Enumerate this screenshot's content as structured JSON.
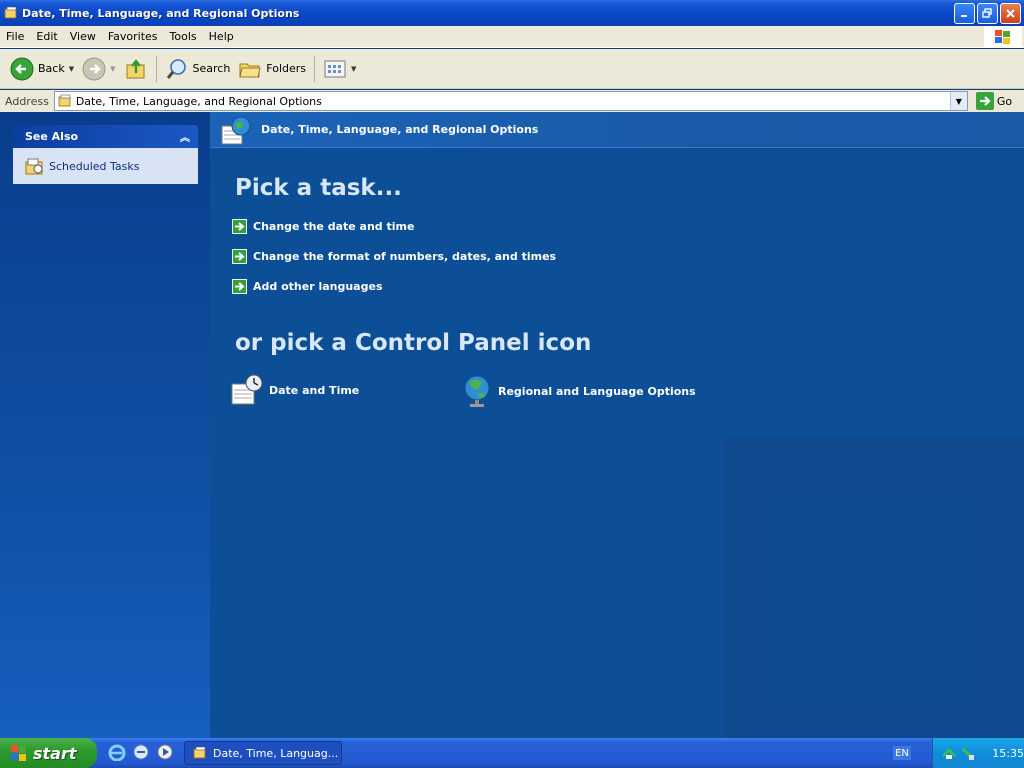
{
  "window": {
    "title": "Date, Time, Language, and Regional Options"
  },
  "menu": {
    "items": [
      "File",
      "Edit",
      "View",
      "Favorites",
      "Tools",
      "Help"
    ]
  },
  "toolbar": {
    "back_label": "Back",
    "search_label": "Search",
    "folders_label": "Folders"
  },
  "address": {
    "label": "Address",
    "value": "Date, Time, Language, and Regional Options",
    "go_label": "Go"
  },
  "sidebar": {
    "see_also_title": "See Also",
    "items": [
      {
        "label": "Scheduled Tasks",
        "icon": "scheduled-tasks-icon"
      }
    ]
  },
  "main": {
    "header_title": "Date, Time, Language, and Regional Options",
    "pick_task_heading": "Pick a task...",
    "tasks": [
      {
        "label": "Change the date and time"
      },
      {
        "label": "Change the format of numbers, dates, and times"
      },
      {
        "label": "Add other languages"
      }
    ],
    "pick_icon_heading": "or pick a Control Panel icon",
    "icons": [
      {
        "label": "Date and Time",
        "icon": "date-time-icon"
      },
      {
        "label": "Regional and Language Options",
        "icon": "globe-icon"
      }
    ]
  },
  "taskbar": {
    "start_label": "start",
    "active_task": "Date, Time, Languag...",
    "language": "EN",
    "clock": "15:35"
  },
  "colors": {
    "title_bar": "#0a47c8",
    "main_pane": "#0c4f96",
    "left_pane": "#0a3e8c",
    "heading": "#d9e6f6",
    "start_green": "#2e9b2e",
    "task_arrow": "#2fa33a"
  }
}
